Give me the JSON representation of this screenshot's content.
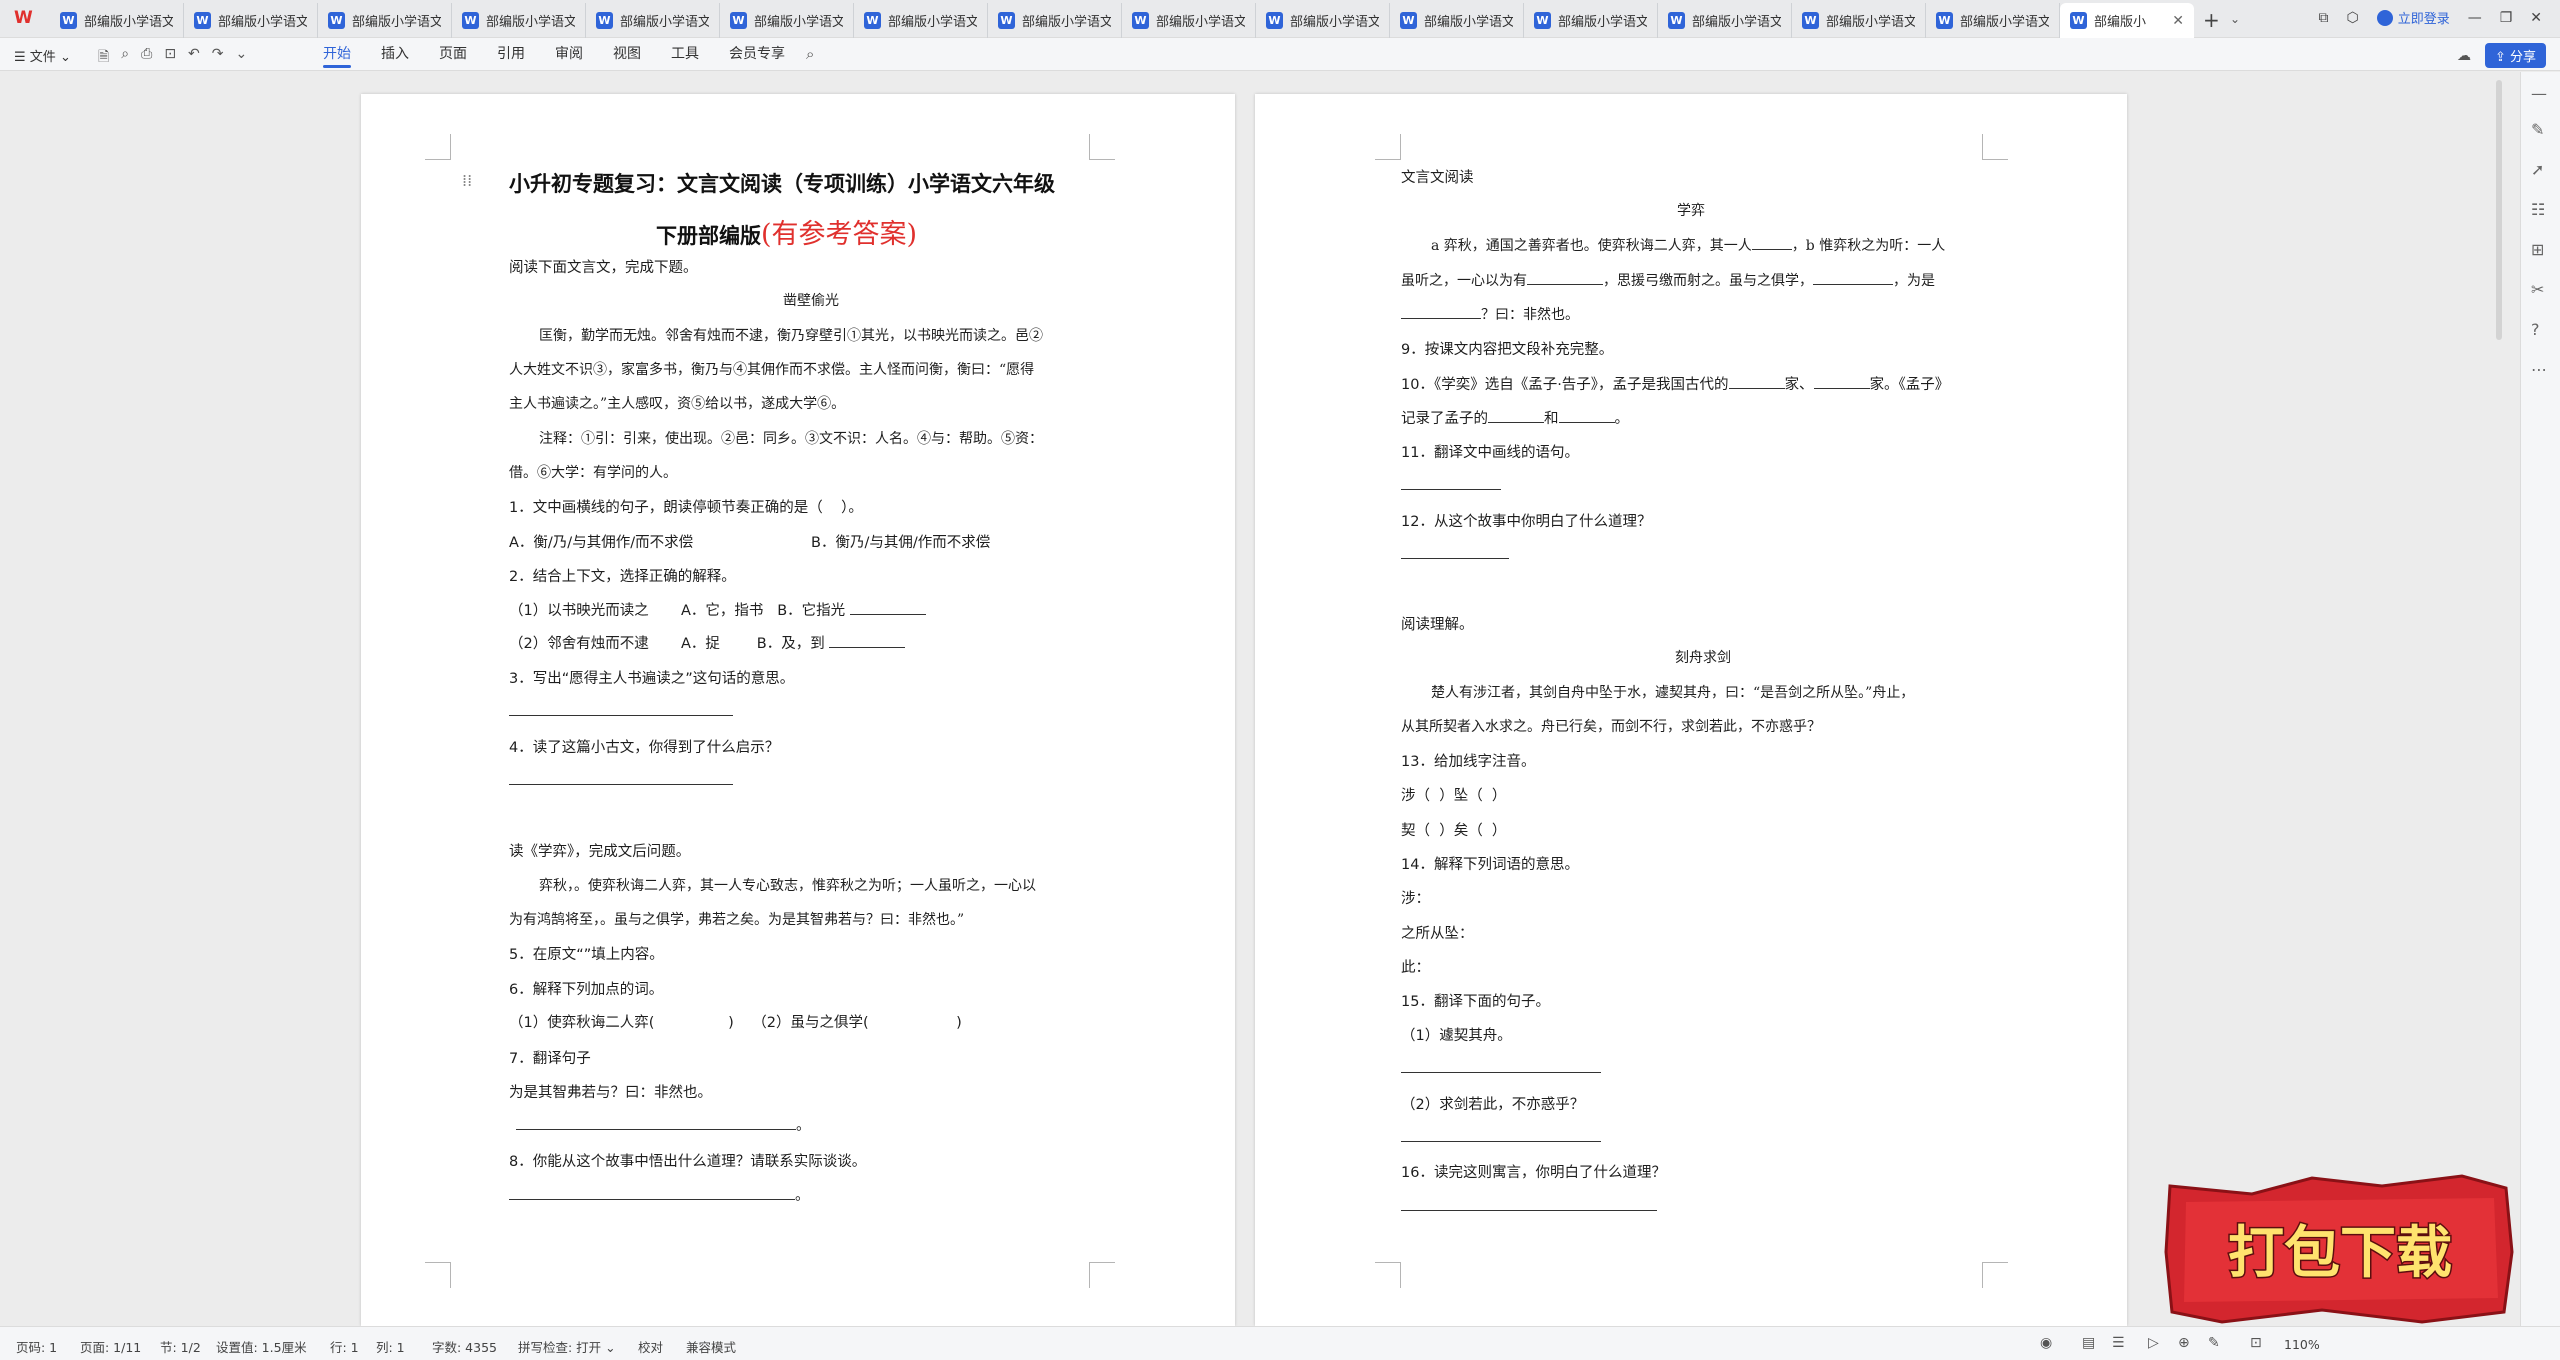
{
  "app": {
    "logo": "W"
  },
  "tabs": {
    "items": [
      {
        "label": "部编版小学语文"
      },
      {
        "label": "部编版小学语文"
      },
      {
        "label": "部编版小学语文"
      },
      {
        "label": "部编版小学语文"
      },
      {
        "label": "部编版小学语文"
      },
      {
        "label": "部编版小学语文"
      },
      {
        "label": "部编版小学语文"
      },
      {
        "label": "部编版小学语文"
      },
      {
        "label": "部编版小学语文"
      },
      {
        "label": "部编版小学语文"
      },
      {
        "label": "部编版小学语文"
      },
      {
        "label": "部编版小学语文"
      },
      {
        "label": "部编版小学语文"
      },
      {
        "label": "部编版小学语文"
      },
      {
        "label": "部编版小学语文"
      }
    ],
    "active_label": "部编版小",
    "new_tab": "+",
    "menu": "⌄"
  },
  "topright": {
    "login": "立即登录",
    "share": "分享"
  },
  "ribbon": {
    "file_menu": "文件",
    "tabs": [
      "开始",
      "插入",
      "页面",
      "引用",
      "审阅",
      "视图",
      "工具",
      "会员专享"
    ],
    "active_tab": "开始"
  },
  "page1": {
    "title_line1": "小升初专题复习：文言文阅读（专项训练）小学语文六年级",
    "title_line2": "下册部编版",
    "title_red": "(有参考答案)",
    "lines": [
      "阅读下面文言文，完成下题。",
      "凿壁偷光",
      "匡衡，勤学而无烛。邻舍有烛而不逮，衡乃穿壁引①其光，以书映光而读之。邑②",
      "人大姓文不识③，家富多书，衡乃与④其佣作而不求偿。主人怪而问衡，衡曰：“愿得",
      "主人书遍读之。”主人感叹，资⑤给以书，遂成大学⑥。",
      "注释：①引：引来，使出现。②邑：同乡。③文不识：人名。④与：帮助。⑤资：",
      "借。⑥大学：有学问的人。",
      "1．文中画横线的句子，朗读停顿节奏正确的是（    ）。",
      "A．衡/乃/与其佣作/而不求偿",
      "B．衡乃/与其佣/作而不求偿",
      "2．结合上下文，选择正确的解释。",
      "（1）以书映光而读之       A．它，指书   B．它指光",
      "（2）邻舍有烛而不逮       A．捉        B．及，到",
      "3．写出“愿得主人书遍读之”这句话的意思。",
      "4．读了这篇小古文，你得到了什么启示？",
      "读《学弈》，完成文后问题。",
      "弈秋，。使弈秋诲二人弈，其一人专心致志，惟弈秋之为听；一人虽听之，一心以",
      "为有鸿鹄将至，。虽与之俱学，弗若之矣。为是其智弗若与？曰：非然也。”",
      "5．在原文“”填上内容。",
      "6．解释下列加点的词。",
      "（1）使弈秋诲二人弈(                )    （2）虽与之俱学(                   )",
      "7．翻译句子",
      "为是其智弗若与？曰：非然也。",
      "8．你能从这个故事中悟出什么道理？请联系实际谈谈。"
    ]
  },
  "page2": {
    "lines": [
      "文言文阅读",
      "学弈",
      "a 弈秋，通国之善弈者也。使弈秋诲二人弈，其一人",
      "，b 惟弈秋之为听：一人",
      "虽听之，一心以为有",
      "，思援弓缴而射之。虽与之俱学，",
      "，为是",
      "？曰：非然也。",
      "9．按课文内容把文段补充完整。",
      "10．《学奕》选自《孟子·告子》，孟子是我国古代的",
      "家、",
      "家。《孟子》",
      "记录了孟子的",
      "和",
      "。",
      "11．翻译文中画线的语句。",
      "12．从这个故事中你明白了什么道理？",
      "阅读理解。",
      "刻舟求剑",
      "楚人有涉江者，其剑自舟中坠于水，遽契其舟，曰：“是吾剑之所从坠。”舟止，",
      "从其所契者入水求之。舟已行矣，而剑不行，求剑若此，不亦惑乎？",
      "13．给加线字注音。",
      "涉（  ）坠（  ）",
      "契（  ）矣（  ）",
      "14．解释下列词语的意思。",
      "涉：",
      "之所从坠：",
      "此：",
      "15．翻译下面的句子。",
      "（1）遽契其舟。",
      "（2）求剑若此，不亦惑乎？",
      "16．读完这则寓言，你明白了什么道理？"
    ]
  },
  "status": {
    "page": "页码: 1",
    "pages": "页面: 1/11",
    "section": "节: 1/2",
    "setting": "设置值: 1.5厘米",
    "row": "行: 1",
    "col": "列: 1",
    "words": "字数: 4355",
    "spell": "拼写检查: 打开",
    "proof": "校对",
    "compat": "兼容模式",
    "zoom": "110%"
  },
  "banner": {
    "text": "打包下载"
  }
}
